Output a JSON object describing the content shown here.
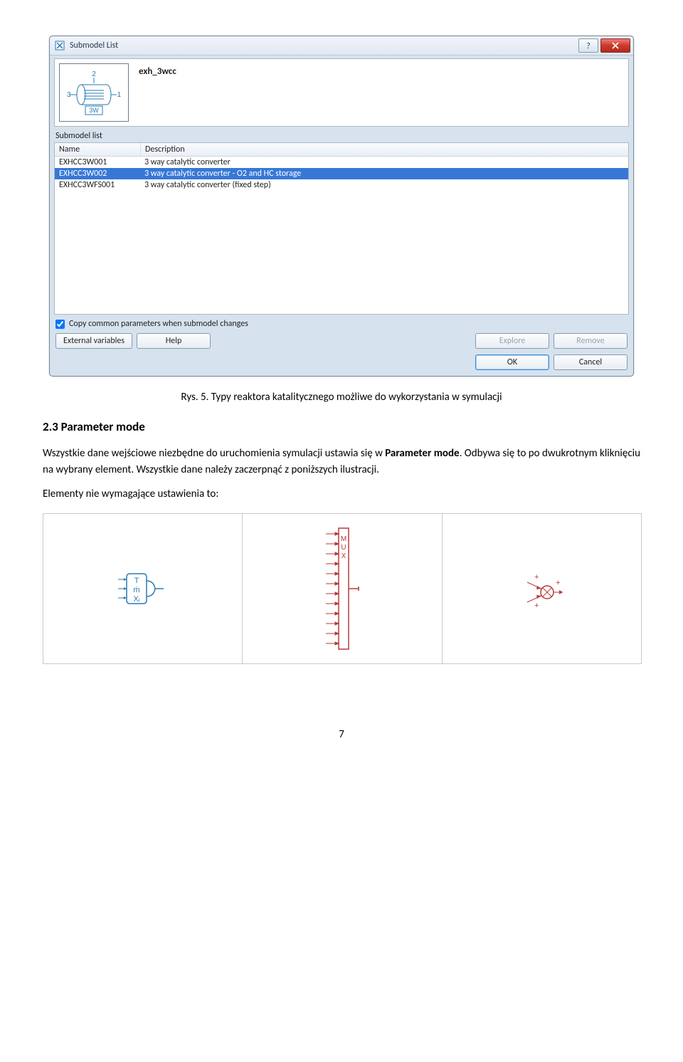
{
  "dialog": {
    "title": "Submodel List",
    "component_label": "exh_3wcc",
    "submodel_list_label": "Submodel list",
    "columns": {
      "name": "Name",
      "description": "Description"
    },
    "rows": [
      {
        "name": "EXHCC3W001",
        "desc": "3 way catalytic converter",
        "selected": false
      },
      {
        "name": "EXHCC3W002",
        "desc": "3 way catalytic converter - O2 and HC storage",
        "selected": true
      },
      {
        "name": "EXHCC3WFS001",
        "desc": "3 way catalytic converter (fixed step)",
        "selected": false
      }
    ],
    "copy_label": "Copy common parameters when submodel changes",
    "buttons": {
      "external": "External variables",
      "help": "Help",
      "explore": "Explore",
      "remove": "Remove",
      "ok": "OK",
      "cancel": "Cancel"
    }
  },
  "doc": {
    "caption": "Rys. 5. Typy reaktora katalitycznego możliwe do wykorzystania w symulacji",
    "heading": "2.3 Parameter mode",
    "para_a": "Wszystkie dane wejściowe niezbędne do uruchomienia symulacji ustawia się w ",
    "para_bold": "Parameter mode",
    "para_b": ". Odbywa się to po dwukrotnym kliknięciu na wybrany element. Wszystkie dane należy zaczerpnąć z poniższych ilustracji.",
    "para2": "Elementy nie wymagające ustawienia to:",
    "page_num": "7"
  },
  "thumb_labels": {
    "top": "2",
    "left": "3",
    "right": "1",
    "bottom": "3W"
  },
  "comp1": {
    "t": "T",
    "m": "ṁ",
    "x": "Xᵢ"
  },
  "comp2": {
    "mux": "MUX"
  }
}
